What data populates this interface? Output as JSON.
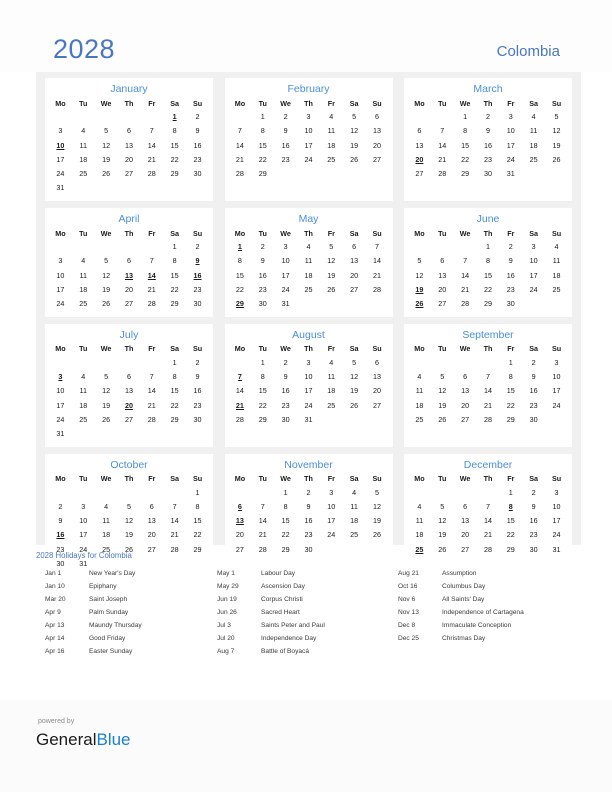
{
  "header": {
    "year": "2028",
    "country": "Colombia"
  },
  "weekdays": [
    "Mo",
    "Tu",
    "We",
    "Th",
    "Fr",
    "Sa",
    "Su"
  ],
  "colors": {
    "accent_blue": "#4a76c4",
    "month_title_blue": "#4a8fd8",
    "holiday_red": "#e00000",
    "grid_background": "#f0f0f0",
    "card_background": "#ffffff",
    "brand_blue": "#1a7fd4"
  },
  "months": [
    {
      "name": "January",
      "lead_blanks": 5,
      "days": 31,
      "holidays": [
        1,
        10
      ]
    },
    {
      "name": "February",
      "lead_blanks": 1,
      "days": 29,
      "holidays": []
    },
    {
      "name": "March",
      "lead_blanks": 2,
      "days": 31,
      "holidays": [
        20
      ]
    },
    {
      "name": "April",
      "lead_blanks": 5,
      "days": 30,
      "holidays": [
        9,
        13,
        14,
        16
      ]
    },
    {
      "name": "May",
      "lead_blanks": 0,
      "days": 31,
      "holidays": [
        1,
        29
      ]
    },
    {
      "name": "June",
      "lead_blanks": 3,
      "days": 30,
      "holidays": [
        19,
        26
      ]
    },
    {
      "name": "July",
      "lead_blanks": 5,
      "days": 31,
      "holidays": [
        3,
        20
      ]
    },
    {
      "name": "August",
      "lead_blanks": 1,
      "days": 31,
      "holidays": [
        7,
        21
      ]
    },
    {
      "name": "September",
      "lead_blanks": 4,
      "days": 30,
      "holidays": []
    },
    {
      "name": "October",
      "lead_blanks": 6,
      "days": 31,
      "holidays": [
        16
      ]
    },
    {
      "name": "November",
      "lead_blanks": 2,
      "days": 30,
      "holidays": [
        6,
        13
      ]
    },
    {
      "name": "December",
      "lead_blanks": 4,
      "days": 31,
      "holidays": [
        8,
        25
      ]
    }
  ],
  "holidays_section": {
    "heading": "2028 Holidays for Colombia",
    "columns": [
      [
        {
          "date": "Jan 1",
          "name": "New Year's Day"
        },
        {
          "date": "Jan 10",
          "name": "Epiphany"
        },
        {
          "date": "Mar 20",
          "name": "Saint Joseph"
        },
        {
          "date": "Apr 9",
          "name": "Palm Sunday"
        },
        {
          "date": "Apr 13",
          "name": "Maundy Thursday"
        },
        {
          "date": "Apr 14",
          "name": "Good Friday"
        },
        {
          "date": "Apr 16",
          "name": "Easter Sunday"
        }
      ],
      [
        {
          "date": "May 1",
          "name": "Labour Day"
        },
        {
          "date": "May 29",
          "name": "Ascension Day"
        },
        {
          "date": "Jun 19",
          "name": "Corpus Christi"
        },
        {
          "date": "Jun 26",
          "name": "Sacred Heart"
        },
        {
          "date": "Jul 3",
          "name": "Saints Peter and Paul"
        },
        {
          "date": "Jul 20",
          "name": "Independence Day"
        },
        {
          "date": "Aug 7",
          "name": "Battle of Boyacá"
        }
      ],
      [
        {
          "date": "Aug 21",
          "name": "Assumption"
        },
        {
          "date": "Oct 16",
          "name": "Columbus Day"
        },
        {
          "date": "Nov 6",
          "name": "All Saints' Day"
        },
        {
          "date": "Nov 13",
          "name": "Independence of Cartagena"
        },
        {
          "date": "Dec 8",
          "name": "Immaculate Conception"
        },
        {
          "date": "Dec 25",
          "name": "Christmas Day"
        }
      ]
    ]
  },
  "footer": {
    "powered_by": "powered by",
    "brand_first": "General",
    "brand_second": "Blue"
  }
}
